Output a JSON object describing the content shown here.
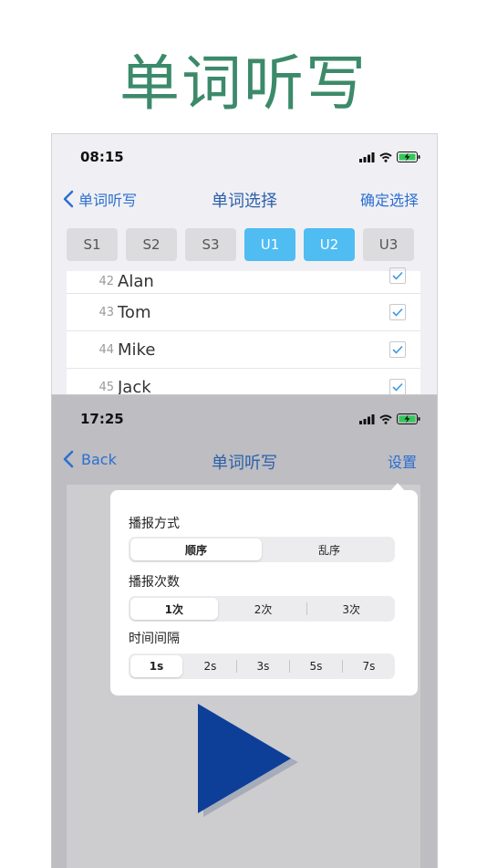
{
  "headline": "单词听写",
  "screen1": {
    "status_time": "08:15",
    "nav": {
      "back_label": "单词听写",
      "title": "单词选择",
      "confirm_label": "确定选择"
    },
    "units": [
      {
        "label": "S1",
        "active": false
      },
      {
        "label": "S2",
        "active": false
      },
      {
        "label": "S3",
        "active": false
      },
      {
        "label": "U1",
        "active": true
      },
      {
        "label": "U2",
        "active": true
      },
      {
        "label": "U3",
        "active": false
      }
    ],
    "words": [
      {
        "num": "42",
        "word": "Alan",
        "checked": true
      },
      {
        "num": "43",
        "word": "Tom",
        "checked": true
      },
      {
        "num": "44",
        "word": "Mike",
        "checked": true
      },
      {
        "num": "45",
        "word": "Jack",
        "checked": true
      }
    ]
  },
  "screen2": {
    "status_time": "17:25",
    "nav": {
      "back_label": "Back",
      "title": "单词听写",
      "settings_label": "设置"
    },
    "settings": {
      "mode_label": "播报方式",
      "mode_options": [
        "顺序",
        "乱序"
      ],
      "mode_selected": 0,
      "count_label": "播报次数",
      "count_options": [
        "1次",
        "2次",
        "3次"
      ],
      "count_selected": 0,
      "interval_label": "时间间隔",
      "interval_options": [
        "1s",
        "2s",
        "3s",
        "5s",
        "7s"
      ],
      "interval_selected": 0
    }
  },
  "colors": {
    "headline": "#3c8a6a",
    "accent_blue": "#2c6fd0",
    "unit_active": "#4fbcf2",
    "play": "#0d3f99"
  },
  "icons": [
    "signal-icon",
    "wifi-icon",
    "battery-charging-icon",
    "chevron-left-icon",
    "checkbox-icon",
    "play-icon"
  ]
}
